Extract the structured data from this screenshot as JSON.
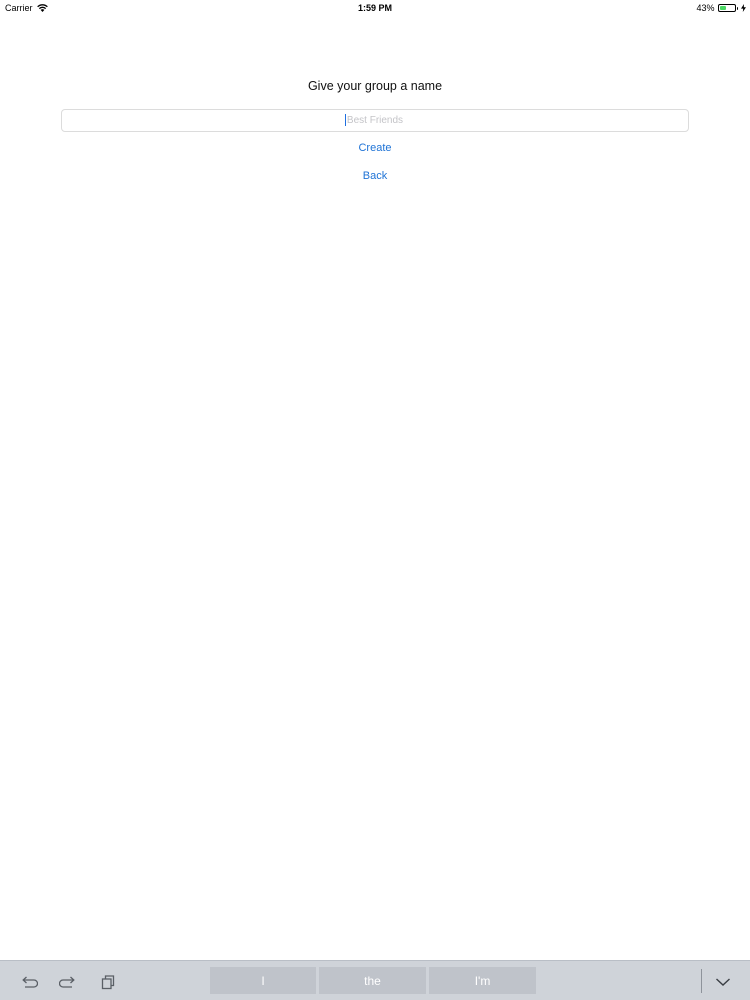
{
  "status_bar": {
    "carrier": "Carrier",
    "time": "1:59 PM",
    "battery_percent": "43%",
    "battery_level": 0.43,
    "icons": [
      "wifi-icon",
      "battery-icon",
      "charging-bolt-icon"
    ]
  },
  "main": {
    "title": "Give your group a name",
    "group_name_input": {
      "value": "",
      "placeholder": "Best Friends"
    },
    "create_label": "Create",
    "back_label": "Back"
  },
  "keyboard_bar": {
    "icons": [
      "undo-icon",
      "redo-icon",
      "paste-icon",
      "keyboard-dismiss-icon"
    ],
    "suggestions": [
      "I",
      "the",
      "I'm"
    ]
  },
  "colors": {
    "accent": "#1f73d6",
    "battery_fill": "#4cd964",
    "keyboard_bar": "#cfd3d9",
    "suggestion_bg": "#bfc3ca"
  }
}
